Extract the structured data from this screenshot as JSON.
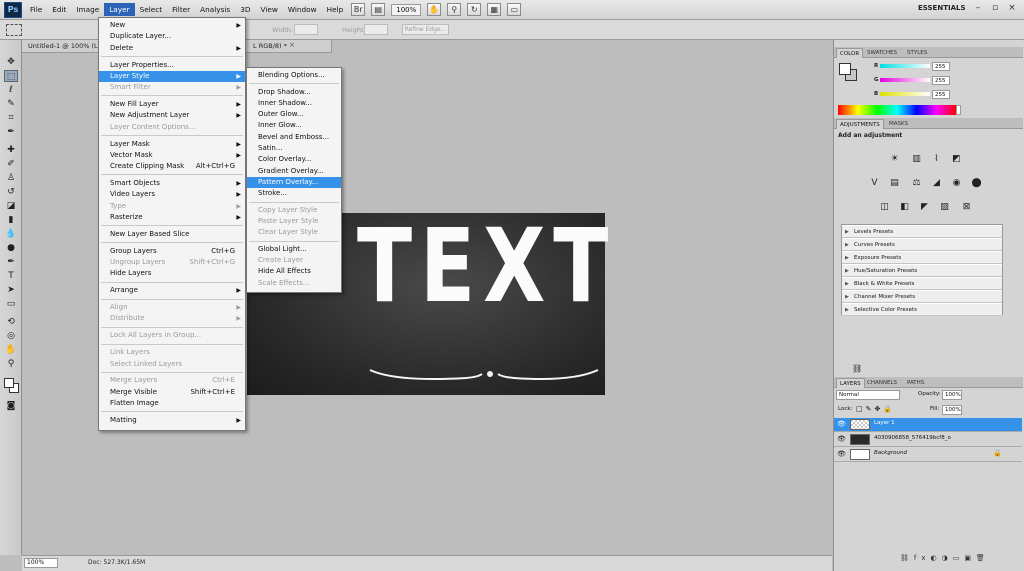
{
  "menubar": {
    "logo": "Ps",
    "items": [
      "File",
      "Edit",
      "Image",
      "Layer",
      "Select",
      "Filter",
      "Analysis",
      "3D",
      "View",
      "Window",
      "Help"
    ],
    "zoom": "100%",
    "workspace": "ESSENTIALS"
  },
  "options": {
    "width_label": "Width:",
    "height_label": "Height:",
    "refine_edge": "Refine Edge..."
  },
  "document": {
    "tab_title": "Untitled-1 @ 100% (La",
    "tab_mode": "L RGB/8) *",
    "close": "×",
    "canvas_text": "TEXT"
  },
  "status": {
    "zoom": "100%",
    "doc": "Doc: 527.3K/1.65M"
  },
  "layer_menu": [
    {
      "label": "New",
      "arrow": true
    },
    {
      "label": "Duplicate Layer..."
    },
    {
      "label": "Delete",
      "arrow": true
    },
    {
      "sep": true
    },
    {
      "label": "Layer Properties..."
    },
    {
      "label": "Layer Style",
      "arrow": true,
      "hl": true
    },
    {
      "label": "Smart Filter",
      "arrow": true,
      "dis": true
    },
    {
      "sep": true
    },
    {
      "label": "New Fill Layer",
      "arrow": true
    },
    {
      "label": "New Adjustment Layer",
      "arrow": true
    },
    {
      "label": "Layer Content Options...",
      "dis": true
    },
    {
      "sep": true
    },
    {
      "label": "Layer Mask",
      "arrow": true
    },
    {
      "label": "Vector Mask",
      "arrow": true
    },
    {
      "label": "Create Clipping Mask",
      "sc": "Alt+Ctrl+G"
    },
    {
      "sep": true
    },
    {
      "label": "Smart Objects",
      "arrow": true
    },
    {
      "label": "Video Layers",
      "arrow": true
    },
    {
      "label": "Type",
      "arrow": true,
      "dis": true
    },
    {
      "label": "Rasterize",
      "arrow": true
    },
    {
      "sep": true
    },
    {
      "label": "New Layer Based Slice"
    },
    {
      "sep": true
    },
    {
      "label": "Group Layers",
      "sc": "Ctrl+G"
    },
    {
      "label": "Ungroup Layers",
      "sc": "Shift+Ctrl+G",
      "dis": true
    },
    {
      "label": "Hide Layers"
    },
    {
      "sep": true
    },
    {
      "label": "Arrange",
      "arrow": true
    },
    {
      "sep": true
    },
    {
      "label": "Align",
      "arrow": true,
      "dis": true
    },
    {
      "label": "Distribute",
      "arrow": true,
      "dis": true
    },
    {
      "sep": true
    },
    {
      "label": "Lock All Layers in Group...",
      "dis": true
    },
    {
      "sep": true
    },
    {
      "label": "Link Layers",
      "dis": true
    },
    {
      "label": "Select Linked Layers",
      "dis": true
    },
    {
      "sep": true
    },
    {
      "label": "Merge Layers",
      "sc": "Ctrl+E",
      "dis": true
    },
    {
      "label": "Merge Visible",
      "sc": "Shift+Ctrl+E"
    },
    {
      "label": "Flatten Image"
    },
    {
      "sep": true
    },
    {
      "label": "Matting",
      "arrow": true
    }
  ],
  "style_menu": [
    {
      "label": "Blending Options..."
    },
    {
      "sep": true
    },
    {
      "label": "Drop Shadow..."
    },
    {
      "label": "Inner Shadow..."
    },
    {
      "label": "Outer Glow..."
    },
    {
      "label": "Inner Glow..."
    },
    {
      "label": "Bevel and Emboss..."
    },
    {
      "label": "Satin..."
    },
    {
      "label": "Color Overlay..."
    },
    {
      "label": "Gradient Overlay..."
    },
    {
      "label": "Pattern Overlay...",
      "hl": true
    },
    {
      "label": "Stroke..."
    },
    {
      "sep": true
    },
    {
      "label": "Copy Layer Style",
      "dis": true
    },
    {
      "label": "Paste Layer Style",
      "dis": true
    },
    {
      "label": "Clear Layer Style",
      "dis": true
    },
    {
      "sep": true
    },
    {
      "label": "Global Light..."
    },
    {
      "label": "Create Layer",
      "dis": true
    },
    {
      "label": "Hide All Effects"
    },
    {
      "label": "Scale Effects...",
      "dis": true
    }
  ],
  "color_panel": {
    "tabs": [
      "COLOR",
      "SWATCHES",
      "STYLES"
    ],
    "channels": [
      {
        "label": "R",
        "value": "255",
        "gradient": "#00e0e0"
      },
      {
        "label": "G",
        "value": "255",
        "gradient": "#e000e0"
      },
      {
        "label": "B",
        "value": "255",
        "gradient": "#e0e000"
      }
    ]
  },
  "adjustments": {
    "tabs": [
      "ADJUSTMENTS",
      "MASKS"
    ],
    "title": "Add an adjustment",
    "presets": [
      "Levels Presets",
      "Curves Presets",
      "Exposure Presets",
      "Hue/Saturation Presets",
      "Black & White Presets",
      "Channel Mixer Presets",
      "Selective Color Presets"
    ]
  },
  "layers_panel": {
    "tabs": [
      "LAYERS",
      "CHANNELS",
      "PATHS"
    ],
    "blend_mode": "Normal",
    "opacity_label": "Opacity:",
    "opacity": "100%",
    "lock_label": "Lock:",
    "fill_label": "Fill:",
    "fill": "100%",
    "layers": [
      {
        "name": "Layer 1",
        "selected": true
      },
      {
        "name": "4030906858_576419bcf8_o"
      },
      {
        "name": "Background",
        "locked": true
      }
    ]
  }
}
